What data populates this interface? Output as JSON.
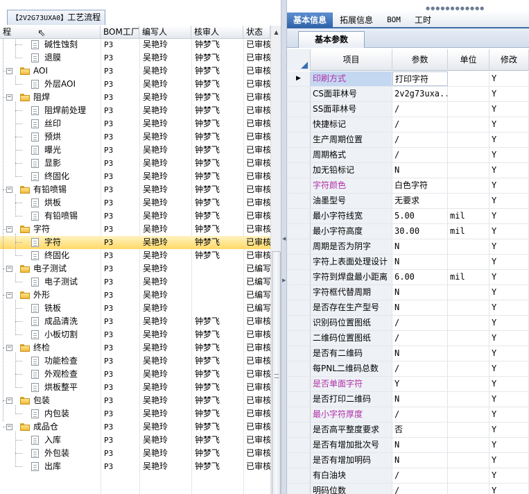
{
  "left_panel": {
    "tab_code": "【2V2G73UXA0】",
    "tab_title": "工艺流程",
    "columns": [
      "程",
      "BOM工厂",
      "编写人",
      "核审人",
      "状态"
    ],
    "rows": [
      {
        "name": "碱性蚀刻",
        "type": "doc",
        "level": 1,
        "bom": "P3",
        "writer": "吴艳玲",
        "reviewer": "钟梦飞",
        "status": "已审核",
        "partial": true
      },
      {
        "name": "退膜",
        "type": "doc",
        "level": 1,
        "bom": "P3",
        "writer": "吴艳玲",
        "reviewer": "钟梦飞",
        "status": "已审核"
      },
      {
        "name": "AOI",
        "type": "folder",
        "level": 0,
        "bom": "P3",
        "writer": "吴艳玲",
        "reviewer": "钟梦飞",
        "status": "已审核"
      },
      {
        "name": "外层AOI",
        "type": "doc",
        "level": 1,
        "bom": "P3",
        "writer": "吴艳玲",
        "reviewer": "钟梦飞",
        "status": "已审核"
      },
      {
        "name": "阻焊",
        "type": "folder",
        "level": 0,
        "bom": "P3",
        "writer": "吴艳玲",
        "reviewer": "钟梦飞",
        "status": "已审核"
      },
      {
        "name": "阻焊前处理",
        "type": "doc",
        "level": 1,
        "bom": "P3",
        "writer": "吴艳玲",
        "reviewer": "钟梦飞",
        "status": "已审核"
      },
      {
        "name": "丝印",
        "type": "doc",
        "level": 1,
        "bom": "P3",
        "writer": "吴艳玲",
        "reviewer": "钟梦飞",
        "status": "已审核"
      },
      {
        "name": "预烘",
        "type": "doc",
        "level": 1,
        "bom": "P3",
        "writer": "吴艳玲",
        "reviewer": "钟梦飞",
        "status": "已审核"
      },
      {
        "name": "曝光",
        "type": "doc",
        "level": 1,
        "bom": "P3",
        "writer": "吴艳玲",
        "reviewer": "钟梦飞",
        "status": "已审核"
      },
      {
        "name": "显影",
        "type": "doc",
        "level": 1,
        "bom": "P3",
        "writer": "吴艳玲",
        "reviewer": "钟梦飞",
        "status": "已审核"
      },
      {
        "name": "终固化",
        "type": "doc",
        "level": 1,
        "bom": "P3",
        "writer": "吴艳玲",
        "reviewer": "钟梦飞",
        "status": "已审核"
      },
      {
        "name": "有铅喷锡",
        "type": "folder",
        "level": 0,
        "bom": "P3",
        "writer": "吴艳玲",
        "reviewer": "钟梦飞",
        "status": "已审核"
      },
      {
        "name": "烘板",
        "type": "doc",
        "level": 1,
        "bom": "P3",
        "writer": "吴艳玲",
        "reviewer": "钟梦飞",
        "status": "已审核"
      },
      {
        "name": "有铅喷锡",
        "type": "doc",
        "level": 1,
        "bom": "P3",
        "writer": "吴艳玲",
        "reviewer": "钟梦飞",
        "status": "已审核"
      },
      {
        "name": "字符",
        "type": "folder",
        "level": 0,
        "bom": "P3",
        "writer": "吴艳玲",
        "reviewer": "钟梦飞",
        "status": "已审核"
      },
      {
        "name": "字符",
        "type": "doc",
        "level": 1,
        "bom": "P3",
        "writer": "吴艳玲",
        "reviewer": "钟梦飞",
        "status": "已审核",
        "selected": true
      },
      {
        "name": "终固化",
        "type": "doc",
        "level": 1,
        "bom": "P3",
        "writer": "吴艳玲",
        "reviewer": "钟梦飞",
        "status": "已审核"
      },
      {
        "name": "电子测试",
        "type": "folder",
        "level": 0,
        "bom": "P3",
        "writer": "吴艳玲",
        "reviewer": "",
        "status": "已编写"
      },
      {
        "name": "电子测试",
        "type": "doc",
        "level": 1,
        "bom": "P3",
        "writer": "吴艳玲",
        "reviewer": "",
        "status": "已编写"
      },
      {
        "name": "外形",
        "type": "folder",
        "level": 0,
        "bom": "P3",
        "writer": "吴艳玲",
        "reviewer": "",
        "status": "已编写"
      },
      {
        "name": "铣板",
        "type": "doc",
        "level": 1,
        "bom": "P3",
        "writer": "吴艳玲",
        "reviewer": "",
        "status": "已编写"
      },
      {
        "name": "成品清洗",
        "type": "doc",
        "level": 1,
        "bom": "P3",
        "writer": "吴艳玲",
        "reviewer": "钟梦飞",
        "status": "已审核"
      },
      {
        "name": "小板切割",
        "type": "doc",
        "level": 1,
        "bom": "P3",
        "writer": "吴艳玲",
        "reviewer": "钟梦飞",
        "status": "已审核"
      },
      {
        "name": "终检",
        "type": "folder",
        "level": 0,
        "bom": "P3",
        "writer": "吴艳玲",
        "reviewer": "钟梦飞",
        "status": "已审核"
      },
      {
        "name": "功能检查",
        "type": "doc",
        "level": 1,
        "bom": "P3",
        "writer": "吴艳玲",
        "reviewer": "钟梦飞",
        "status": "已审核"
      },
      {
        "name": "外观检查",
        "type": "doc",
        "level": 1,
        "bom": "P3",
        "writer": "吴艳玲",
        "reviewer": "钟梦飞",
        "status": "已审核"
      },
      {
        "name": "烘板整平",
        "type": "doc",
        "level": 1,
        "bom": "P3",
        "writer": "吴艳玲",
        "reviewer": "钟梦飞",
        "status": "已审核"
      },
      {
        "name": "包装",
        "type": "folder",
        "level": 0,
        "bom": "P3",
        "writer": "吴艳玲",
        "reviewer": "钟梦飞",
        "status": "已审核"
      },
      {
        "name": "内包装",
        "type": "doc",
        "level": 1,
        "bom": "P3",
        "writer": "吴艳玲",
        "reviewer": "钟梦飞",
        "status": "已审核"
      },
      {
        "name": "成品仓",
        "type": "folder",
        "level": 0,
        "bom": "P3",
        "writer": "吴艳玲",
        "reviewer": "钟梦飞",
        "status": "已审核"
      },
      {
        "name": "入库",
        "type": "doc",
        "level": 1,
        "bom": "P3",
        "writer": "吴艳玲",
        "reviewer": "钟梦飞",
        "status": "已审核"
      },
      {
        "name": "外包装",
        "type": "doc",
        "level": 1,
        "bom": "P3",
        "writer": "吴艳玲",
        "reviewer": "钟梦飞",
        "status": "已审核"
      },
      {
        "name": "出库",
        "type": "doc",
        "level": 1,
        "bom": "P3",
        "writer": "吴艳玲",
        "reviewer": "钟梦飞",
        "status": "已审核",
        "last": true
      }
    ]
  },
  "right_panel": {
    "top_tabs": [
      "基本信息",
      "拓展信息",
      "BOM",
      "工时"
    ],
    "active_tab": 0,
    "sub_tab": "基本参数",
    "columns": [
      "项目",
      "参数",
      "单位",
      "修改"
    ],
    "rows": [
      {
        "item": "印刷方式",
        "param": "打印字符",
        "unit": "",
        "modify": "Y",
        "purple": true,
        "selected": true
      },
      {
        "item": "CS面菲林号",
        "param": "2v2g73uxa...",
        "unit": "",
        "modify": "Y"
      },
      {
        "item": "SS面菲林号",
        "param": "/",
        "unit": "",
        "modify": "Y"
      },
      {
        "item": "快捷标记",
        "param": "/",
        "unit": "",
        "modify": "Y"
      },
      {
        "item": "生产周期位置",
        "param": "/",
        "unit": "",
        "modify": "Y"
      },
      {
        "item": "周期格式",
        "param": "/",
        "unit": "",
        "modify": "Y"
      },
      {
        "item": "加无铅标记",
        "param": "N",
        "unit": "",
        "modify": "Y"
      },
      {
        "item": "字符颜色",
        "param": "白色字符",
        "unit": "",
        "modify": "Y",
        "purple": true
      },
      {
        "item": "油墨型号",
        "param": "无要求",
        "unit": "",
        "modify": "Y"
      },
      {
        "item": "最小字符线宽",
        "param": "5.00",
        "unit": "mil",
        "modify": "Y"
      },
      {
        "item": "最小字符高度",
        "param": "30.00",
        "unit": "mil",
        "modify": "Y"
      },
      {
        "item": "周期是否为阴字",
        "param": "N",
        "unit": "",
        "modify": "Y"
      },
      {
        "item": "字符上表面处理设计",
        "param": "N",
        "unit": "",
        "modify": "Y"
      },
      {
        "item": "字符到焊盘最小距离",
        "param": "6.00",
        "unit": "mil",
        "modify": "Y"
      },
      {
        "item": "字符框代替周期",
        "param": "N",
        "unit": "",
        "modify": "Y"
      },
      {
        "item": "是否存在生产型号",
        "param": "N",
        "unit": "",
        "modify": "Y"
      },
      {
        "item": "识别码位置图纸",
        "param": "/",
        "unit": "",
        "modify": "Y"
      },
      {
        "item": "二维码位置图纸",
        "param": "/",
        "unit": "",
        "modify": "Y"
      },
      {
        "item": "是否有二维码",
        "param": "N",
        "unit": "",
        "modify": "Y"
      },
      {
        "item": "每PNL二维码总数",
        "param": "/",
        "unit": "",
        "modify": "Y"
      },
      {
        "item": "是否单面字符",
        "param": "Y",
        "unit": "",
        "modify": "Y",
        "purple": true
      },
      {
        "item": "是否打印二维码",
        "param": "N",
        "unit": "",
        "modify": "Y"
      },
      {
        "item": "最小字符厚度",
        "param": "/",
        "unit": "",
        "modify": "Y",
        "purple": true
      },
      {
        "item": "是否高平整度要求",
        "param": "否",
        "unit": "",
        "modify": "Y"
      },
      {
        "item": "是否有增加批次号",
        "param": "N",
        "unit": "",
        "modify": "Y"
      },
      {
        "item": "是否有增加明码",
        "param": "N",
        "unit": "",
        "modify": "Y"
      },
      {
        "item": "有白油块",
        "param": "/",
        "unit": "",
        "modify": "Y"
      },
      {
        "item": "明码位数",
        "param": "/",
        "unit": "",
        "modify": "Y"
      }
    ]
  },
  "colors": {
    "purple_label": "#b02fa8",
    "selection": "#ffd966",
    "tab_active": "#2f62a8"
  }
}
